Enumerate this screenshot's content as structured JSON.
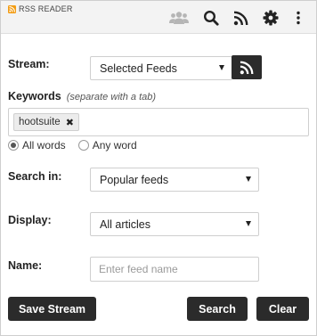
{
  "header": {
    "title": "RSS READER",
    "brand_icon": "rss-small-icon",
    "brand_color": "#f39c12",
    "toolbar": [
      {
        "icon": "users-icon",
        "state": "disabled"
      },
      {
        "icon": "search-icon"
      },
      {
        "icon": "rss-icon"
      },
      {
        "icon": "gear-icon"
      },
      {
        "icon": "more-vertical-icon"
      }
    ]
  },
  "stream": {
    "label": "Stream:",
    "selected": "Selected Feeds",
    "button_icon": "rss-icon"
  },
  "keywords": {
    "label": "Keywords",
    "hint": "(separate with a tab)",
    "tags": [
      "hootsuite"
    ],
    "remove_icon": "close-icon",
    "match_options": [
      {
        "label": "All words",
        "checked": true
      },
      {
        "label": "Any word",
        "checked": false
      }
    ]
  },
  "search_in": {
    "label": "Search in:",
    "selected": "Popular feeds"
  },
  "display": {
    "label": "Display:",
    "selected": "All articles"
  },
  "name": {
    "label": "Name:",
    "placeholder": "Enter feed name",
    "value": ""
  },
  "actions": {
    "save": "Save Stream",
    "search": "Search",
    "clear": "Clear"
  },
  "colors": {
    "button_bg": "#2b2b2b",
    "header_bg": "#f3f3f3",
    "border": "#cfcfcf",
    "disabled_icon": "#b5b5b5"
  }
}
